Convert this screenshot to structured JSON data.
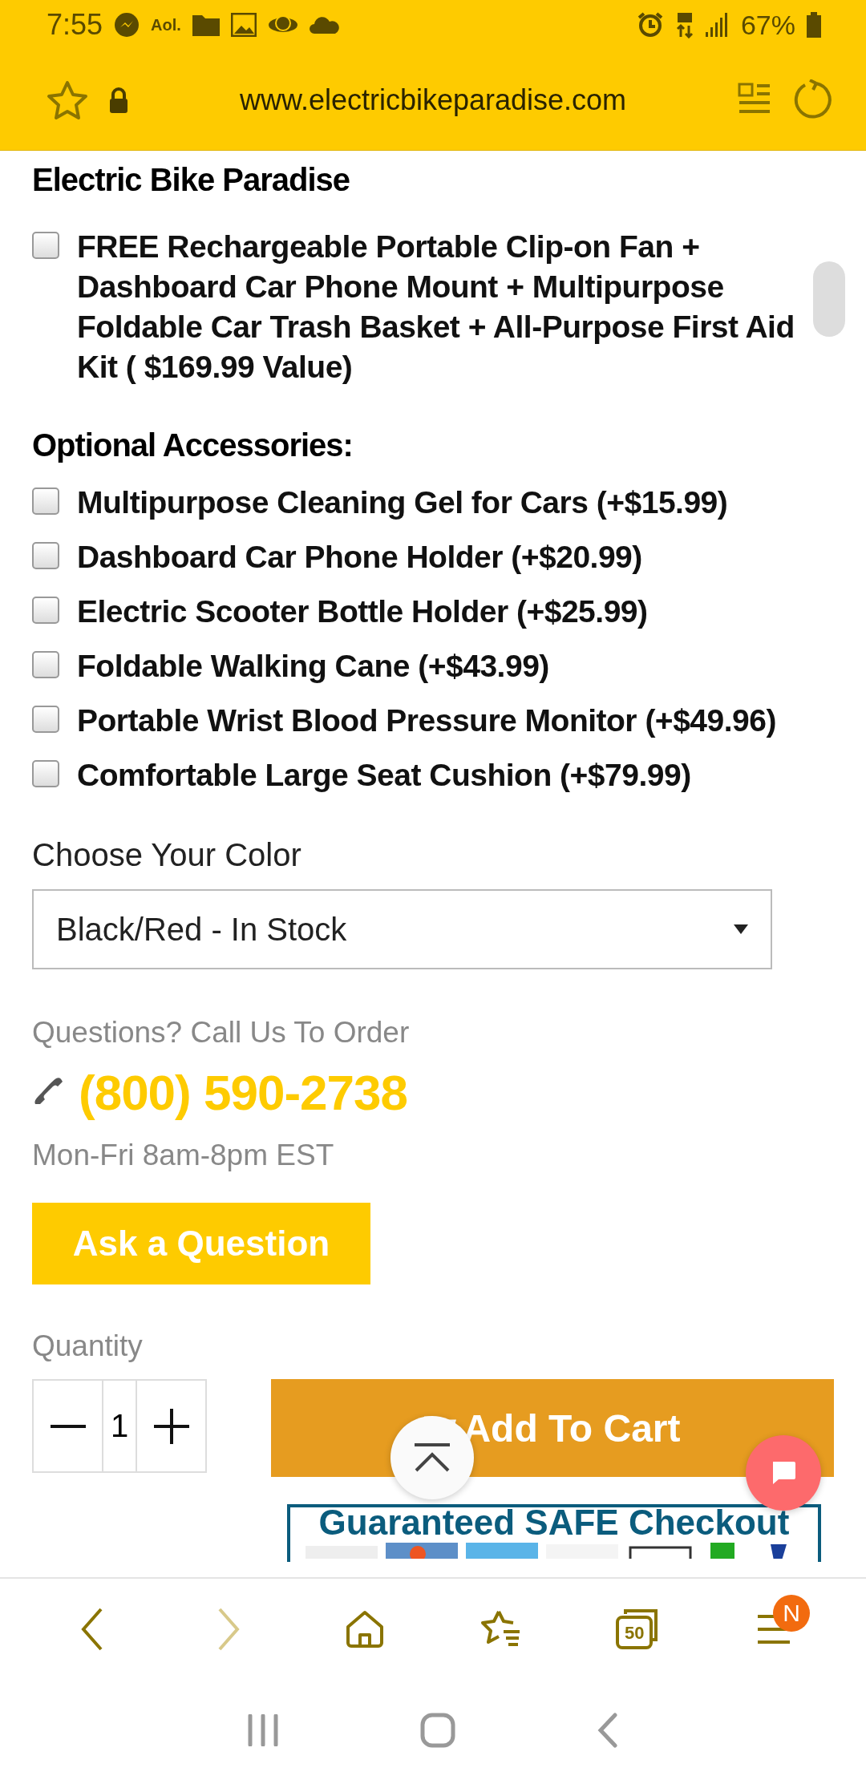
{
  "status_bar": {
    "time": "7:55",
    "aol": "Aol.",
    "battery": "67%"
  },
  "browser": {
    "url": "www.electricbikeparadise.com",
    "forward_disabled": true,
    "tab_count": "50",
    "menu_badge": "N"
  },
  "heading": "Electric Bike Paradise",
  "free_gift": {
    "label": "FREE Rechargeable Portable Clip-on Fan + Dashboard Car Phone Mount + Multipurpose Foldable Car Trash Basket + All-Purpose First Aid Kit ( $169.99 Value)",
    "checked": false
  },
  "accessories": {
    "title": "Optional Accessories:",
    "items": [
      {
        "label": "Multipurpose Cleaning Gel for Cars (+$15.99)",
        "checked": false
      },
      {
        "label": "Dashboard Car Phone Holder (+$20.99)",
        "checked": false
      },
      {
        "label": "Electric Scooter Bottle Holder (+$25.99)",
        "checked": false
      },
      {
        "label": "Foldable Walking Cane (+$43.99)",
        "checked": false
      },
      {
        "label": "Portable Wrist Blood Pressure Monitor (+$49.96)",
        "checked": false
      },
      {
        "label": "Comfortable Large Seat Cushion (+$79.99)",
        "checked": false
      }
    ]
  },
  "color": {
    "label": "Choose Your Color",
    "value": "Black/Red - In Stock"
  },
  "contact": {
    "prompt": "Questions? Call Us To Order",
    "phone": "(800) 590-2738",
    "hours": "Mon-Fri 8am-8pm EST"
  },
  "ask_button": "Ask a Question",
  "quantity": {
    "label": "Quantity",
    "value": "1"
  },
  "cart_button": "Add To Cart",
  "checkout_banner": "Guaranteed SAFE Checkout"
}
